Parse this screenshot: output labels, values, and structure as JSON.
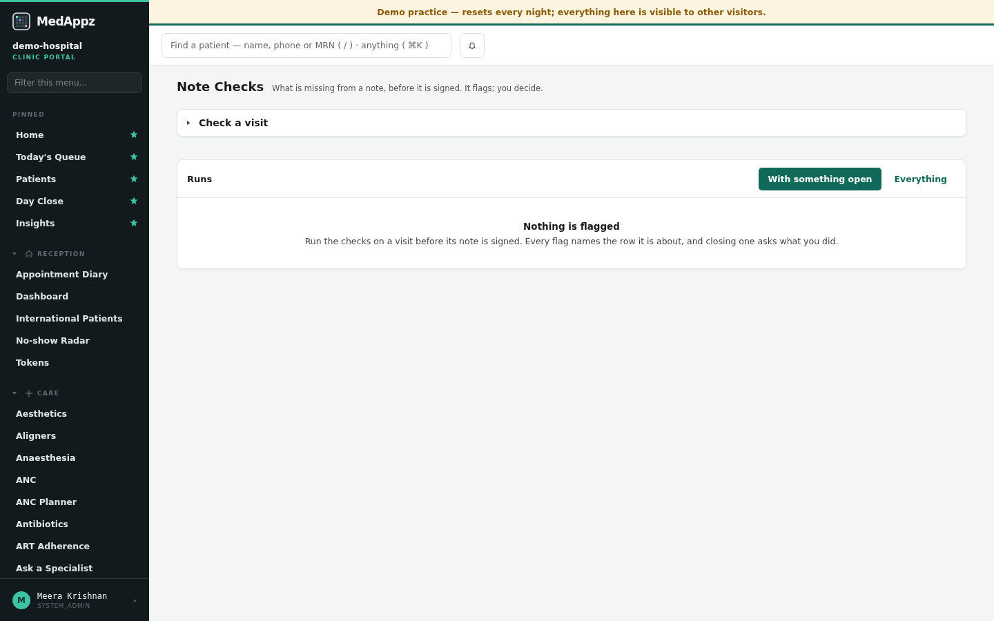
{
  "brand": {
    "name": "MedAppz",
    "org": "demo-hospital",
    "portal": "CLINIC PORTAL"
  },
  "sidebar": {
    "filter_placeholder": "Filter this menu...",
    "sections": [
      {
        "title": "PINNED",
        "kind": "pinned",
        "items": [
          {
            "label": "Home",
            "pinned": true
          },
          {
            "label": "Today's Queue",
            "pinned": true
          },
          {
            "label": "Patients",
            "pinned": true
          },
          {
            "label": "Day Close",
            "pinned": true
          },
          {
            "label": "Insights",
            "pinned": true
          }
        ]
      },
      {
        "title": "RECEPTION",
        "kind": "reception",
        "expanded": true,
        "items": [
          {
            "label": "Appointment Diary",
            "pinned": false
          },
          {
            "label": "Dashboard",
            "pinned": false
          },
          {
            "label": "International Patients",
            "pinned": false
          },
          {
            "label": "No-show Radar",
            "pinned": false
          },
          {
            "label": "Tokens",
            "pinned": false
          }
        ]
      },
      {
        "title": "CARE",
        "kind": "care",
        "expanded": true,
        "items": [
          {
            "label": "Aesthetics",
            "pinned": false
          },
          {
            "label": "Aligners",
            "pinned": false
          },
          {
            "label": "Anaesthesia",
            "pinned": false
          },
          {
            "label": "ANC",
            "pinned": false
          },
          {
            "label": "ANC Planner",
            "pinned": false
          },
          {
            "label": "Antibiotics",
            "pinned": false
          },
          {
            "label": "ART Adherence",
            "pinned": false
          },
          {
            "label": "Ask a Specialist",
            "pinned": false
          }
        ]
      }
    ],
    "user": {
      "initial": "M",
      "name": "Meera Krishnan",
      "role": "SYSTEM_ADMIN"
    }
  },
  "banner": "Demo practice — resets every night; everything here is visible to other visitors.",
  "search": {
    "placeholder": "Find a patient — name, phone or MRN ( / ) · anything ( ⌘K )"
  },
  "page": {
    "title": "Note Checks",
    "subtitle": "What is missing from a note, before it is signed. It flags; you decide.",
    "check_panel": {
      "title": "Check a visit",
      "expanded": false
    },
    "runs": {
      "title": "Runs",
      "filters": [
        {
          "label": "With something open",
          "selected": true
        },
        {
          "label": "Everything",
          "selected": false
        }
      ],
      "empty_title": "Nothing is flagged",
      "empty_text": "Run the checks on a visit before its note is signed. Every flag names the row it is about, and closing one asks what you did."
    }
  }
}
